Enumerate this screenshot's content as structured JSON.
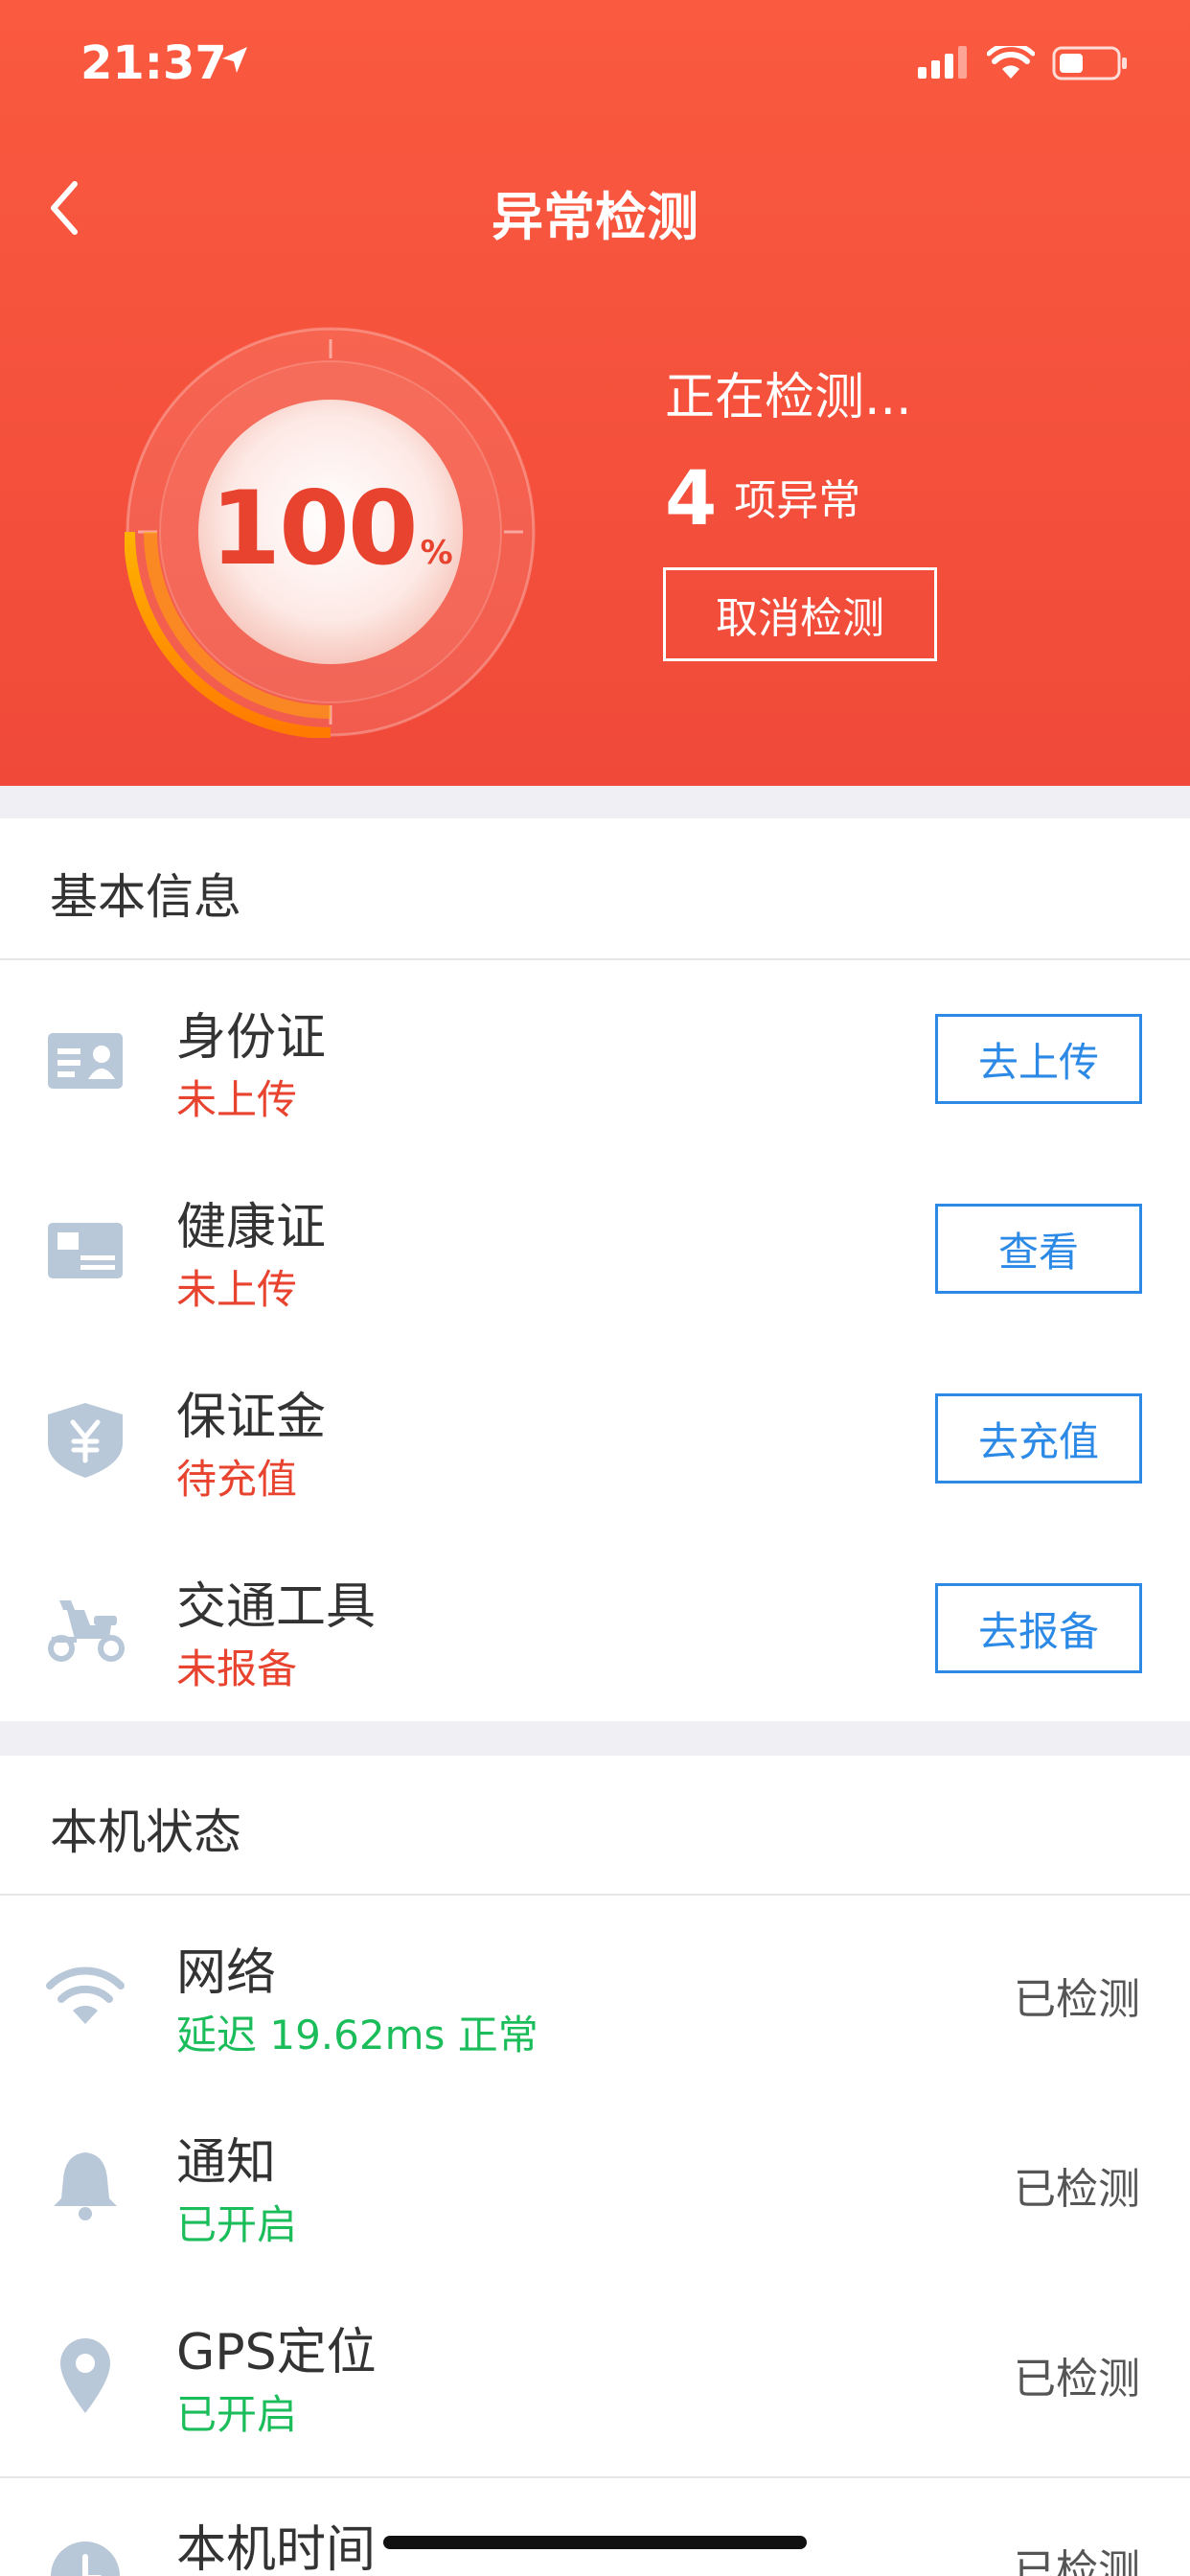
{
  "status_bar": {
    "time": "21:37"
  },
  "header": {
    "title": "异常检测"
  },
  "gauge": {
    "percent": "100",
    "unit": "%"
  },
  "detection": {
    "status": "正在检测...",
    "anomaly_count": "4",
    "anomaly_label": "项异常",
    "cancel_label": "取消检测"
  },
  "basic_info": {
    "title": "基本信息",
    "items": [
      {
        "name": "身份证",
        "status": "未上传",
        "action": "去上传",
        "icon": "id-card-icon"
      },
      {
        "name": "健康证",
        "status": "未上传",
        "action": "查看",
        "icon": "health-card-icon"
      },
      {
        "name": "保证金",
        "status": "待充值",
        "action": "去充值",
        "icon": "shield-yen-icon"
      },
      {
        "name": "交通工具",
        "status": "未报备",
        "action": "去报备",
        "icon": "scooter-icon"
      }
    ]
  },
  "device_status": {
    "title": "本机状态",
    "items": [
      {
        "name": "网络",
        "status": "延迟 19.62ms 正常",
        "state": "已检测",
        "icon": "wifi-icon"
      },
      {
        "name": "通知",
        "status": "已开启",
        "state": "已检测",
        "icon": "bell-icon"
      },
      {
        "name": "GPS定位",
        "status": "已开启",
        "state": "已检测",
        "icon": "location-pin-icon"
      },
      {
        "name": "本机时间",
        "status": "",
        "state": "已检测",
        "icon": "clock-icon"
      }
    ]
  },
  "colors": {
    "header": "#f0493a",
    "alert": "#e8432f",
    "ok": "#1bbd5a",
    "action": "#2c8ae6",
    "icon": "#b9c8d8"
  }
}
